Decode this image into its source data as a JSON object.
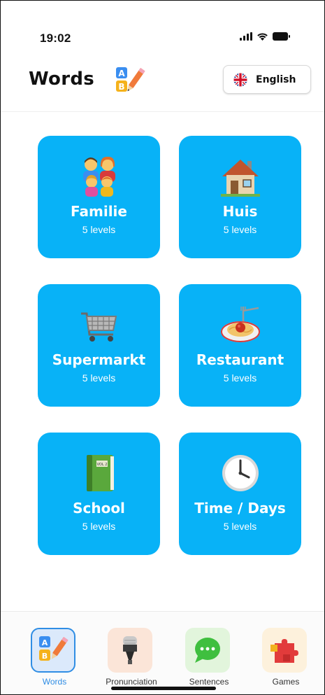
{
  "status_bar": {
    "time": "19:02"
  },
  "header": {
    "title": "Words",
    "language_button_label": "English"
  },
  "categories": [
    {
      "name": "Familie",
      "levels": "5 levels",
      "icon": "family-icon"
    },
    {
      "name": "Huis",
      "levels": "5 levels",
      "icon": "house-icon"
    },
    {
      "name": "Supermarkt",
      "levels": "5 levels",
      "icon": "shopping-cart-icon"
    },
    {
      "name": "Restaurant",
      "levels": "5 levels",
      "icon": "spaghetti-icon"
    },
    {
      "name": "School",
      "levels": "5 levels",
      "icon": "book-icon"
    },
    {
      "name": "Time / Days",
      "levels": "5 levels",
      "icon": "clock-icon"
    }
  ],
  "tab_bar": {
    "active_tab": "Words",
    "tabs": [
      {
        "label": "Words",
        "icon": "abc-pencil-icon"
      },
      {
        "label": "Pronunciation",
        "icon": "microphone-icon"
      },
      {
        "label": "Sentences",
        "icon": "speech-bubble-icon"
      },
      {
        "label": "Games",
        "icon": "puzzle-piece-icon"
      }
    ]
  },
  "colors": {
    "card_bg": "#08b2f7",
    "active_tab_border": "#2f8de4",
    "active_tab_label": "#2f8de4"
  }
}
